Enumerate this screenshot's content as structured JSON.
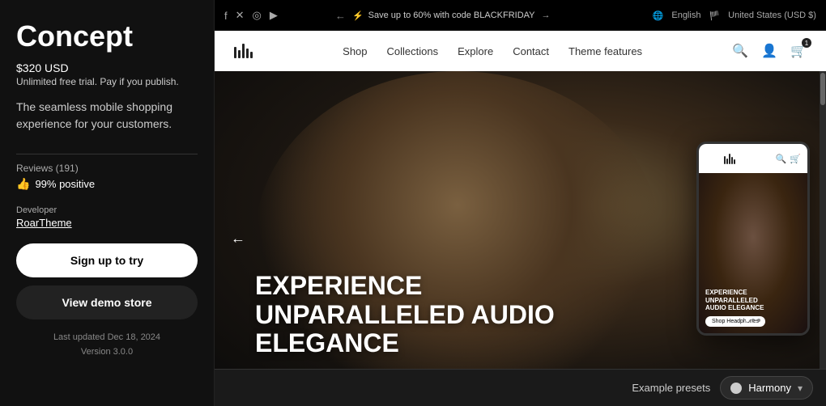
{
  "left": {
    "title": "Concept",
    "price": "$320 USD",
    "trial_text": "Unlimited free trial.",
    "pay_text": " Pay if you publish.",
    "description": "The seamless mobile shopping experience for your customers.",
    "reviews_label": "Reviews (191)",
    "reviews_positive": "99% positive",
    "developer_label": "Developer",
    "developer_name": "RoarTheme",
    "signup_label": "Sign up to try",
    "demo_label": "View demo store",
    "last_updated": "Last updated Dec 18, 2024",
    "version": "Version 3.0.0"
  },
  "browser": {
    "promo_text": "Save up to 60% with code BLACKFRIDAY",
    "lang": "English",
    "region": "United States (USD $)",
    "nav_links": [
      "Shop",
      "Collections",
      "Explore",
      "Contact",
      "Theme features"
    ],
    "hero_headline_line1": "EXPERIENCE",
    "hero_headline_line2": "UNPARALLELED AUDIO",
    "hero_headline_line3": "ELEGANCE",
    "mobile_hero_line1": "EXPERIENCE",
    "mobile_hero_line2": "UNPARALLELED",
    "mobile_hero_line3": "AUDIO ELEGANCE",
    "mobile_shop_btn": "Shop Headphones"
  },
  "bottom": {
    "presets_label": "Example presets",
    "preset_name": "Harmony",
    "chevron": "▾"
  }
}
